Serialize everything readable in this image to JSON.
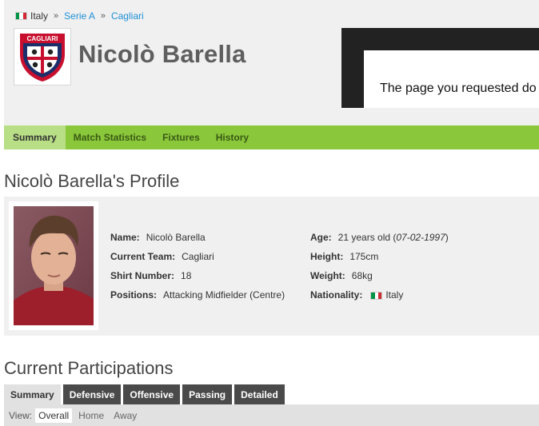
{
  "breadcrumb": {
    "country": "Italy",
    "league": "Serie A",
    "team": "Cagliari",
    "separator": "»"
  },
  "team_logo": {
    "text": "CAGLIARI",
    "icon": "cagliari-crest-icon"
  },
  "player_name": "Nicolò Barella",
  "ad": {
    "text": "The page you requested do"
  },
  "nav": {
    "tabs": [
      "Summary",
      "Match Statistics",
      "Fixtures",
      "History"
    ],
    "active": "Summary"
  },
  "profile": {
    "title": "Nicolò Barella's Profile",
    "photo_icon": "player-photo",
    "left": [
      {
        "label": "Name:",
        "value": "Nicolò Barella"
      },
      {
        "label": "Current Team:",
        "value": "Cagliari"
      },
      {
        "label": "Shirt Number:",
        "value": "18"
      },
      {
        "label": "Positions:",
        "value": "Attacking Midfielder (Centre)"
      }
    ],
    "right": [
      {
        "label": "Age:",
        "value": "21 years old (",
        "value_em": "07-02-1997",
        "value_end": ")"
      },
      {
        "label": "Height:",
        "value": "175cm"
      },
      {
        "label": "Weight:",
        "value": "68kg"
      },
      {
        "label": "Nationality:",
        "value": "Italy"
      }
    ]
  },
  "participations": {
    "title": "Current Participations",
    "tabs": [
      "Summary",
      "Defensive",
      "Offensive",
      "Passing",
      "Detailed"
    ],
    "active_tab": "Summary",
    "view_label": "View:",
    "view_options": [
      "Overall",
      "Home",
      "Away"
    ],
    "active_view": "Overall"
  },
  "colors": {
    "nav_green": "#8ac73b",
    "nav_active": "#b8df86",
    "link_blue": "#1f8fd6",
    "panel_grey": "#f0f0f0",
    "tab_dark": "#4a4a4a"
  }
}
